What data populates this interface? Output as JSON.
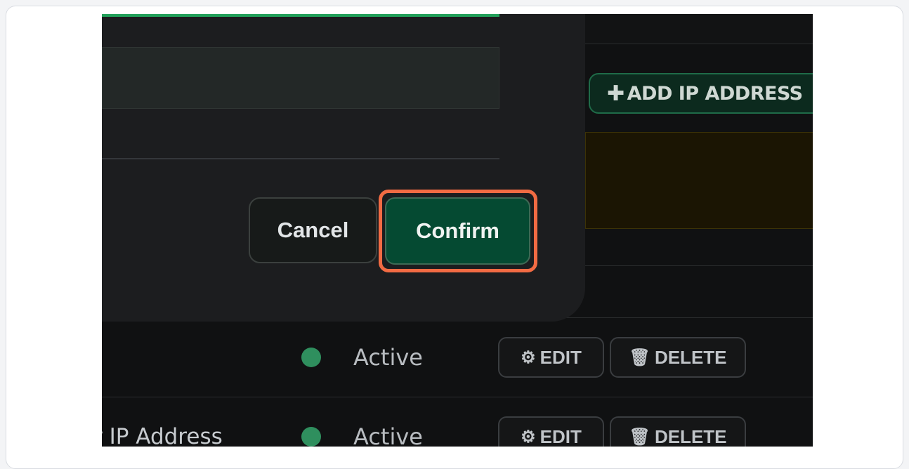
{
  "toolbar": {
    "add_ip_label": "ADD IP ADDRESS",
    "add_icon": "plus-icon"
  },
  "modal": {
    "input_value": "",
    "cancel_label": "Cancel",
    "confirm_label": "Confirm"
  },
  "table": {
    "rows": [
      {
        "name": "",
        "status": "Active",
        "status_color": "#2f8f5e",
        "edit_label": "EDIT",
        "delete_label": "DELETE"
      },
      {
        "name": "r IP Address",
        "status": "Active",
        "status_color": "#2f8f5e",
        "edit_label": "EDIT",
        "delete_label": "DELETE"
      }
    ]
  },
  "colors": {
    "highlight": "#f26b43",
    "confirm_bg": "#054a32",
    "accent_green": "#22a05a"
  }
}
